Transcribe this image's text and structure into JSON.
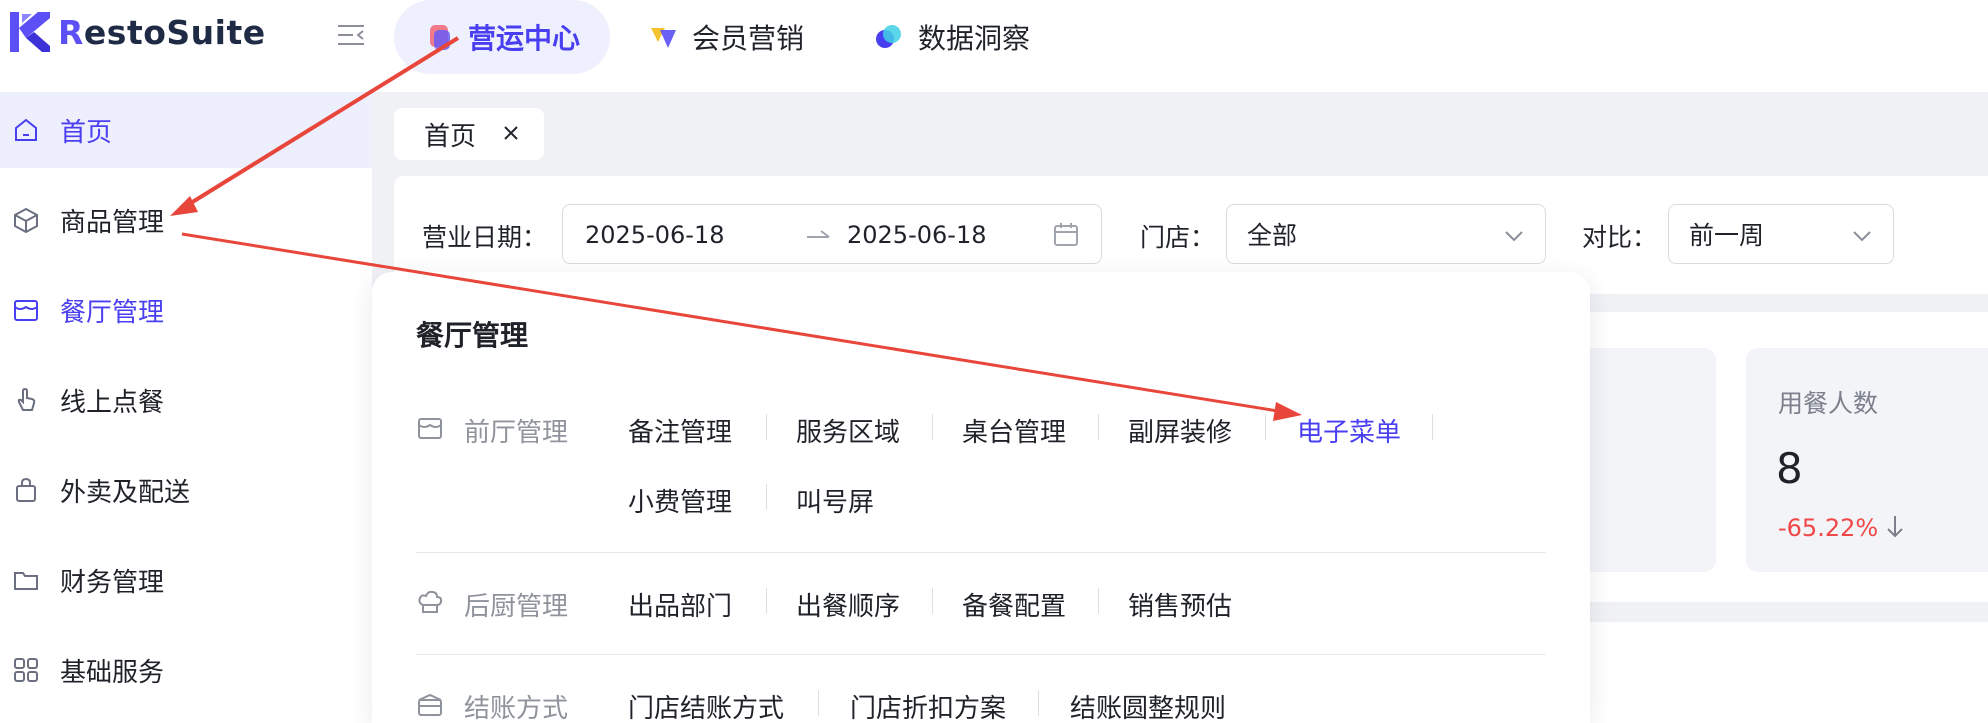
{
  "app": {
    "logo_text": "RestoSuite"
  },
  "top_tabs": [
    {
      "label": "营运中心",
      "active": true,
      "icon": "ops-center-icon"
    },
    {
      "label": "会员营销",
      "active": false,
      "icon": "member-marketing-icon"
    },
    {
      "label": "数据洞察",
      "active": false,
      "icon": "data-insight-icon"
    }
  ],
  "sidebar": {
    "items": [
      {
        "label": "首页",
        "icon": "home-icon",
        "active": true
      },
      {
        "label": "商品管理",
        "icon": "box-icon",
        "active": false
      },
      {
        "label": "餐厅管理",
        "icon": "store-icon",
        "active": false,
        "highlighted": true
      },
      {
        "label": "线上点餐",
        "icon": "tap-icon",
        "active": false
      },
      {
        "label": "外卖及配送",
        "icon": "bag-icon",
        "active": false
      },
      {
        "label": "财务管理",
        "icon": "folder-icon",
        "active": false
      },
      {
        "label": "基础服务",
        "icon": "grid-icon",
        "active": false
      }
    ]
  },
  "page_tab": {
    "label": "首页"
  },
  "filters": {
    "business_date_label": "营业日期：",
    "date_start": "2025-06-18",
    "date_end": "2025-06-18",
    "store_label": "门店：",
    "store_value": "全部",
    "compare_label": "对比：",
    "compare_value": "前一周"
  },
  "stats": {
    "diners_label": "用餐人数",
    "diners_value": "8",
    "diners_change": "-65.22%"
  },
  "menu": {
    "title": "餐厅管理",
    "sections": [
      {
        "label": "前厅管理",
        "icon": "front-hall-icon",
        "links": [
          "备注管理",
          "服务区域",
          "桌台管理",
          "副屏装修",
          "电子菜单",
          "小费管理",
          "叫号屏"
        ],
        "selected": "电子菜单"
      },
      {
        "label": "后厨管理",
        "icon": "chef-hat-icon",
        "links": [
          "出品部门",
          "出餐顺序",
          "备餐配置",
          "销售预估"
        ]
      },
      {
        "label": "结账方式",
        "icon": "payment-icon",
        "links": [
          "门店结账方式",
          "门店折扣方案",
          "结账圆整规则"
        ]
      }
    ]
  },
  "colors": {
    "accent": "#4a3ff0",
    "annotation_arrow": "#e8463a",
    "negative": "#f04848"
  }
}
